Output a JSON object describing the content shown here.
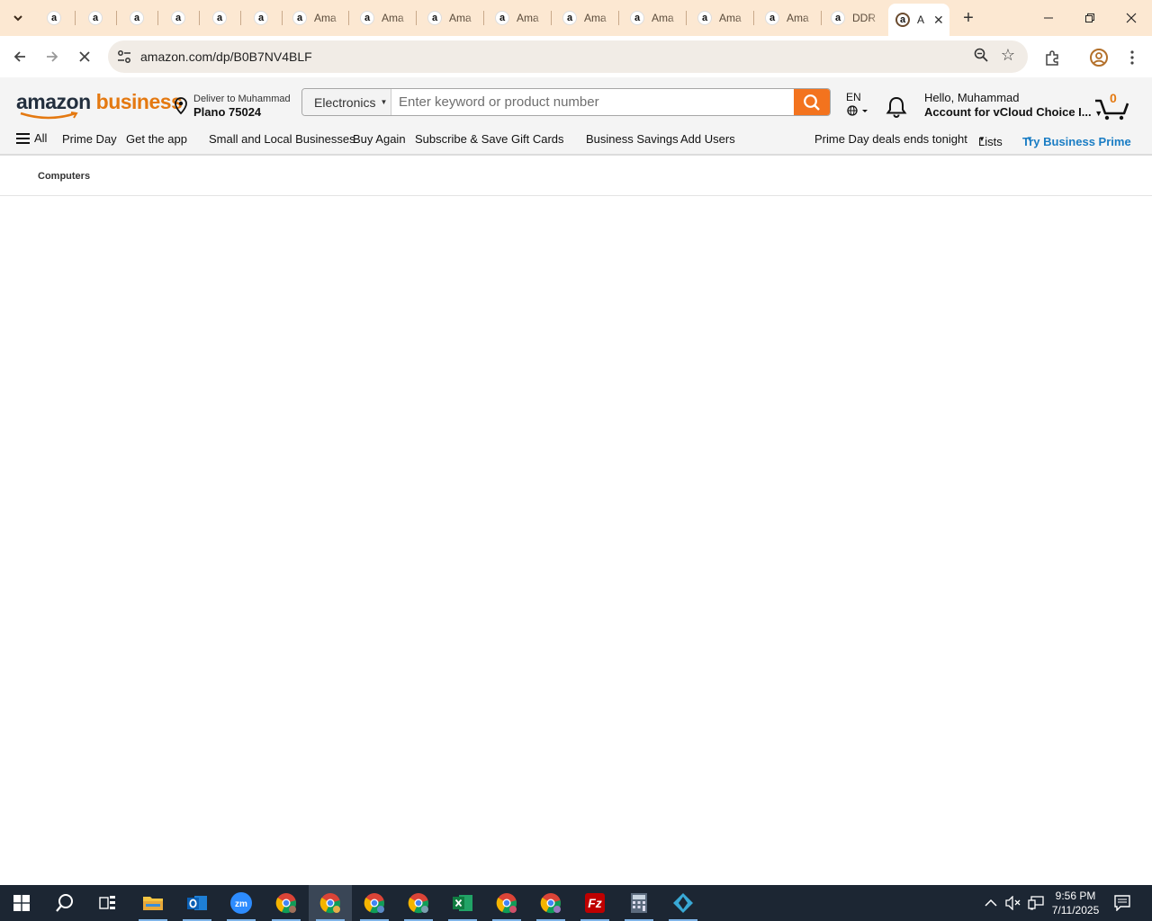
{
  "browser": {
    "tabs": [
      {
        "title": ""
      },
      {
        "title": ""
      },
      {
        "title": ""
      },
      {
        "title": ""
      },
      {
        "title": ""
      },
      {
        "title": ""
      },
      {
        "title": "Ama"
      },
      {
        "title": "Ama"
      },
      {
        "title": "Ama"
      },
      {
        "title": "Ama"
      },
      {
        "title": "Ama"
      },
      {
        "title": "Ama"
      },
      {
        "title": "Ama"
      },
      {
        "title": "Ama"
      },
      {
        "title": "DDR"
      },
      {
        "title": "A"
      }
    ],
    "url": "amazon.com/dp/B0B7NV4BLF"
  },
  "header": {
    "logo_amazon": "amazon",
    "logo_business": "business",
    "deliver_line1": "Deliver to Muhammad",
    "deliver_line2": "Plano 75024",
    "search_department": "Electronics",
    "search_placeholder": "Enter keyword or product number",
    "language": "EN",
    "account_line1": "Hello, Muhammad",
    "account_line2": "Account for vCloud Choice I...",
    "cart_count": "0"
  },
  "subnav": {
    "all": "All",
    "items": [
      "Prime Day",
      "Get the app",
      "Small and Local Businesses",
      "Buy Again",
      "Subscribe & Save",
      "Gift Cards",
      "Business Savings",
      "Add Users"
    ],
    "deals": "Prime Day deals ends tonight",
    "lists": "Lists",
    "try_prime": "Try Business Prime"
  },
  "breadcrumb": {
    "label": "Computers"
  },
  "taskbar": {
    "time": "9:56 PM",
    "date": "7/11/2025",
    "apps": [
      "start-icon",
      "search-icon",
      "task-view-icon",
      "file-explorer-icon",
      "outlook-icon",
      "zoom-icon",
      "chrome-icon",
      "chrome-icon",
      "chrome-icon",
      "chrome-icon",
      "excel-icon",
      "chrome-icon",
      "chrome-icon",
      "filezilla-icon",
      "calculator-icon",
      "app-icon"
    ]
  },
  "colors": {
    "amazon_orange": "#e47911",
    "search_button": "#f3731e",
    "tab_strip": "#fce8d2",
    "prime_blue": "#1a7dc4",
    "taskbar": "#1c2633"
  }
}
